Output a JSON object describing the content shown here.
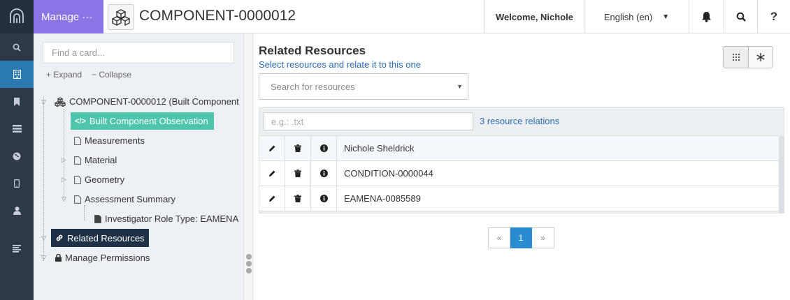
{
  "topbar": {
    "manage_label": "Manage ···",
    "resource_title": "COMPONENT-0000012",
    "welcome": "Welcome, Nichole",
    "language": "English (en)"
  },
  "rail": {
    "icons": [
      "logo-icon",
      "search-icon",
      "building-icon",
      "bookmark-icon",
      "list-icon",
      "globe-icon",
      "mobile-icon",
      "user-icon",
      "menu-icon"
    ]
  },
  "tree": {
    "find_placeholder": "Find a card...",
    "expand_label": "Expand",
    "collapse_label": "Collapse",
    "root": "COMPONENT-0000012 (Built Component",
    "nodes": {
      "observation": "Built Component Observation",
      "measurements": "Measurements",
      "material": "Material",
      "geometry": "Geometry",
      "assessment": "Assessment Summary",
      "investigator": "Investigator Role Type: EAMENA",
      "related": "Related Resources",
      "permissions": "Manage Permissions"
    }
  },
  "main": {
    "title": "Related Resources",
    "subtitle": "Select resources and relate it to this one",
    "search_placeholder": "Search for resources",
    "filter_placeholder": "e.g.: .txt",
    "relation_count": "3 resource relations",
    "rows": [
      "Nichole Sheldrick",
      "CONDITION-0000044",
      "EAMENA-0085589"
    ],
    "pager": {
      "prev": "«",
      "current": "1",
      "next": "»"
    }
  },
  "colors": {
    "manage_bg": "#8b74e6",
    "rail_bg": "#2d3947",
    "selected_node": "#4fc6ab",
    "dark_node": "#1f3147",
    "link_blue": "#2a6cb3",
    "page_active": "#2a8cd0"
  }
}
